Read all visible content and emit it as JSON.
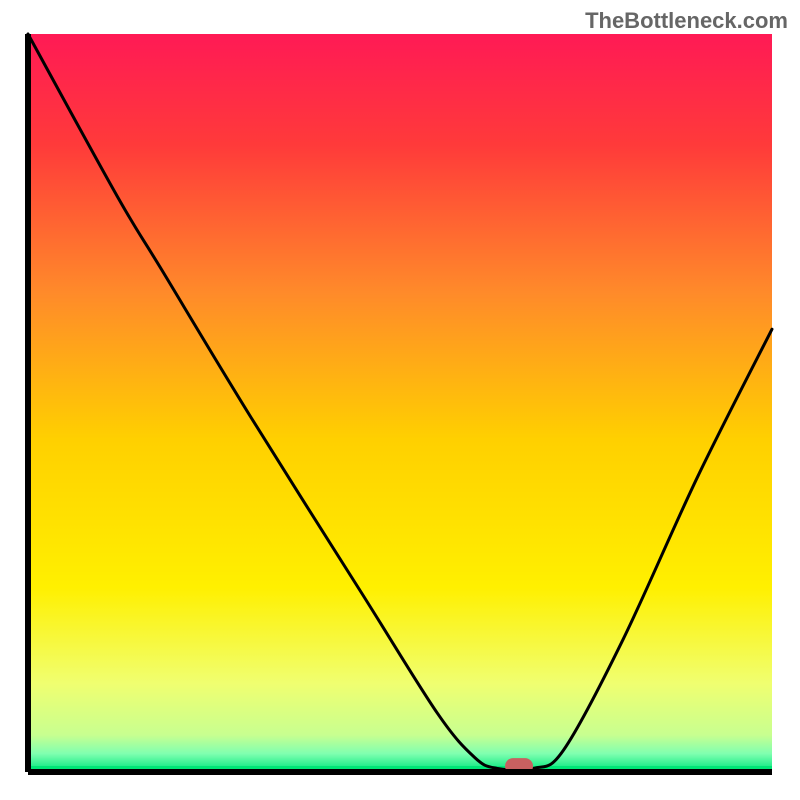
{
  "watermark": "TheBottleneck.com",
  "chart_data": {
    "type": "line",
    "title": "",
    "xlabel": "",
    "ylabel": "",
    "xlim": [
      0,
      100
    ],
    "ylim": [
      0,
      100
    ],
    "gradient_colors": {
      "top": "#ff1a4a",
      "upper_mid": "#ff7a2a",
      "mid": "#ffd500",
      "lower_mid": "#f5ff5a",
      "bottom_band": "#d4ff8a",
      "bottom_line": "#00e676"
    },
    "curve": [
      {
        "x": 0,
        "y": 100
      },
      {
        "x": 12,
        "y": 78
      },
      {
        "x": 18,
        "y": 68
      },
      {
        "x": 30,
        "y": 48
      },
      {
        "x": 45,
        "y": 24
      },
      {
        "x": 55,
        "y": 8
      },
      {
        "x": 60,
        "y": 2
      },
      {
        "x": 63,
        "y": 0.5
      },
      {
        "x": 68,
        "y": 0.5
      },
      {
        "x": 72,
        "y": 3
      },
      {
        "x": 80,
        "y": 18
      },
      {
        "x": 90,
        "y": 40
      },
      {
        "x": 100,
        "y": 60
      }
    ],
    "marker": {
      "x": 66,
      "y": 0.8,
      "color": "#c86060"
    },
    "axes_color": "#000000"
  }
}
